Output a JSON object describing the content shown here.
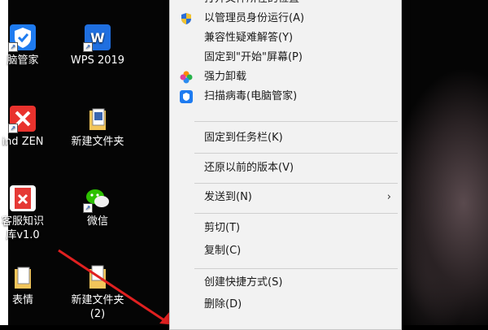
{
  "desktop": {
    "icons": [
      {
        "label": "脑管家",
        "icon": "tencent-pc-manager-icon"
      },
      {
        "label": "WPS 2019",
        "icon": "wps-icon"
      },
      {
        "label": "ind ZEN",
        "icon": "xmind-zen-icon"
      },
      {
        "label": "新建文件夹",
        "icon": "folder-icon"
      },
      {
        "label_line1": "客服知识",
        "label_line2": "库v1.0",
        "icon": "document-app-icon"
      },
      {
        "label": "微信",
        "icon": "wechat-icon"
      },
      {
        "label": "表情",
        "icon": "folder-icon"
      },
      {
        "label_line1": "新建文件夹",
        "label_line2": "(2)",
        "icon": "folder-icon"
      }
    ]
  },
  "context_menu": {
    "top_partial": "打开文件所在的位置",
    "items": [
      {
        "label": "以管理员身份运行(A)",
        "icon": "uac-shield-icon"
      },
      {
        "label": "兼容性疑难解答(Y)"
      },
      {
        "label": "固定到\"开始\"屏幕(P)"
      },
      {
        "label": "强力卸载",
        "icon": "uninstall-flower-icon"
      },
      {
        "label": "扫描病毒(电脑管家)",
        "icon": "pc-manager-shield-icon"
      },
      {
        "label": "固定到任务栏(K)"
      },
      {
        "label": "还原以前的版本(V)"
      },
      {
        "label": "发送到(N)",
        "submenu": true
      },
      {
        "label": "剪切(T)"
      },
      {
        "label": "复制(C)"
      },
      {
        "label": "创建快捷方式(S)"
      },
      {
        "label": "删除(D)"
      }
    ]
  },
  "colors": {
    "menu_bg": "#f2f2f2",
    "arrow": "#e02020",
    "folder": "#f3c55a"
  }
}
